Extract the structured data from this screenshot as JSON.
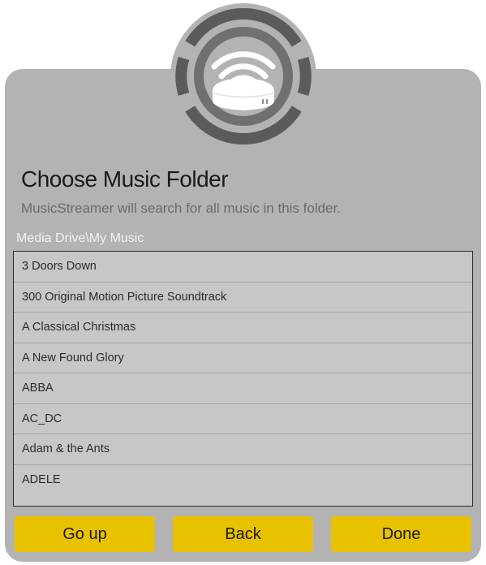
{
  "header": {
    "title": "Choose Music Folder",
    "subtitle": "MusicStreamer will search for all music in this folder.",
    "current_path": "Media Drive\\My Music"
  },
  "folders": [
    "3 Doors Down",
    "300 Original Motion Picture Soundtrack",
    "A Classical Christmas",
    "A New Found Glory",
    "ABBA",
    "AC_DC",
    "Adam & the Ants",
    "ADELE"
  ],
  "buttons": {
    "go_up": "Go up",
    "back": "Back",
    "done": "Done"
  },
  "colors": {
    "card_bg": "#b3b3b3",
    "accent": "#e8c100",
    "list_border": "#2b2b2b"
  },
  "logo": {
    "name": "music-streamer-device-icon"
  }
}
